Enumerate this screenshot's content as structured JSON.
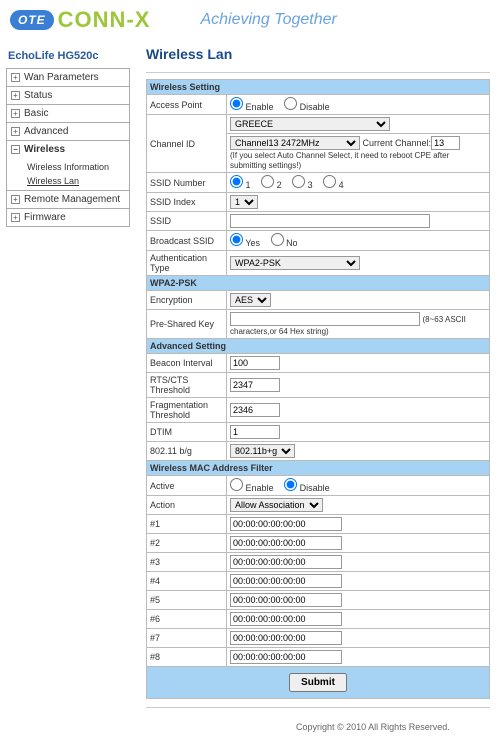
{
  "header": {
    "logo_ote": "OTE",
    "logo_connx": "CONN-X",
    "tagline": "Achieving Together"
  },
  "sidebar": {
    "device": "EchoLife HG520c",
    "items": [
      {
        "label": "Wan Parameters",
        "icon": "+"
      },
      {
        "label": "Status",
        "icon": "+"
      },
      {
        "label": "Basic",
        "icon": "+"
      },
      {
        "label": "Advanced",
        "icon": "+"
      },
      {
        "label": "Wireless",
        "icon": "−",
        "active": true
      },
      {
        "label": "Remote Management",
        "icon": "+"
      },
      {
        "label": "Firmware",
        "icon": "+"
      }
    ],
    "wireless_sub": [
      {
        "label": "Wireless Information"
      },
      {
        "label": "Wireless Lan",
        "current": true
      }
    ]
  },
  "main": {
    "title": "Wireless Lan",
    "sections": {
      "wireless_setting": "Wireless Setting",
      "wpa2psk": "WPA2-PSK",
      "advanced": "Advanced Setting",
      "mac_filter": "Wireless MAC Address Filter"
    },
    "labels": {
      "access_point": "Access Point",
      "channel_id": "Channel ID",
      "ssid_number": "SSID Number",
      "ssid_index": "SSID Index",
      "ssid": "SSID",
      "broadcast_ssid": "Broadcast SSID",
      "auth_type": "Authentication Type",
      "encryption": "Encryption",
      "psk": "Pre-Shared Key",
      "beacon": "Beacon Interval",
      "rts": "RTS/CTS Threshold",
      "frag": "Fragmentation Threshold",
      "dtim": "DTIM",
      "bg": "802.11 b/g",
      "active": "Active",
      "action": "Action",
      "mac1": "#1",
      "mac2": "#2",
      "mac3": "#3",
      "mac4": "#4",
      "mac5": "#5",
      "mac6": "#6",
      "mac7": "#7",
      "mac8": "#8"
    },
    "options": {
      "enable": "Enable",
      "disable": "Disable",
      "yes": "Yes",
      "no": "No"
    },
    "values": {
      "country": "GREECE",
      "channel": "Channel13 2472MHz",
      "current_channel_label": "Current Channel:",
      "current_channel": "13",
      "channel_hint": "(If you select Auto Channel Select, it need to reboot CPE after submitting settings!)",
      "ssid_num_opts": [
        "1",
        "2",
        "3",
        "4"
      ],
      "ssid_index": "1",
      "ssid": "",
      "auth_type": "WPA2-PSK",
      "encryption": "AES",
      "psk": "",
      "psk_hint": "(8~63 ASCII characters,or 64 Hex string)",
      "beacon": "100",
      "rts": "2347",
      "frag": "2346",
      "dtim": "1",
      "bg": "802.11b+g",
      "action": "Allow Association",
      "mac_default": "00:00:00:00:00:00"
    },
    "submit": "Submit"
  },
  "footer": "Copyright © 2010 All Rights Reserved."
}
